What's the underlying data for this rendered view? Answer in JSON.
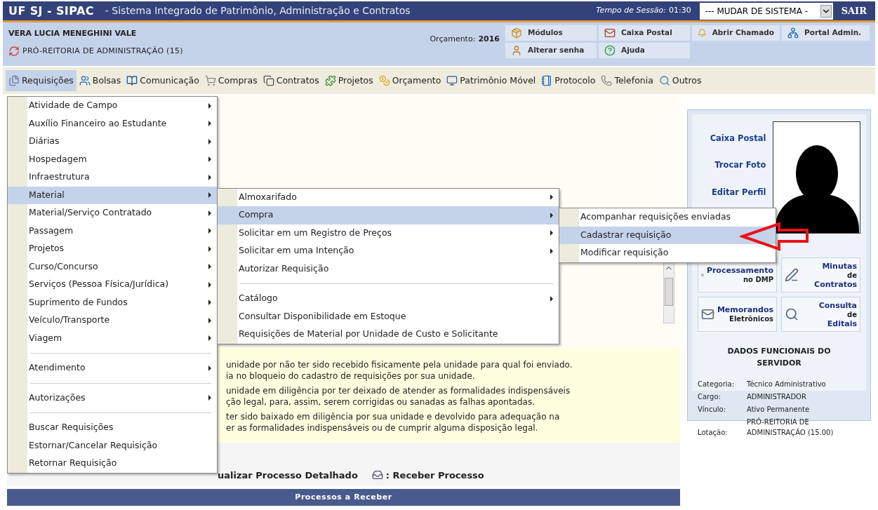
{
  "header": {
    "system_name": "UF SJ - SIPAC",
    "system_description": "- Sistema Integrado de Patrimônio, Administração e Contratos",
    "session_label": "Tempo de Sessão:",
    "session_time": "01:30",
    "system_select": "--- MUDAR DE SISTEMA -",
    "logout": "SAIR"
  },
  "user": {
    "name": "VERA LUCIA MENEGHINI VALE",
    "unit": "PRÓ-REITORIA DE ADMINISTRAÇÃO (15)",
    "budget_label": "Orçamento:",
    "budget_year": "2016"
  },
  "shortcuts": [
    {
      "kind": "modules",
      "label": "Módulos"
    },
    {
      "kind": "mail",
      "label": "Caixa Postal"
    },
    {
      "kind": "bell",
      "label": "Abrir Chamado"
    },
    {
      "kind": "portal",
      "label": "Portal Admin."
    },
    {
      "kind": "user",
      "label": "Alterar senha"
    },
    {
      "kind": "help",
      "label": "Ajuda"
    }
  ],
  "menubar": [
    {
      "kind": "files",
      "label": "Requisições",
      "selected": true
    },
    {
      "kind": "users",
      "label": "Bolsas",
      "selected": false
    },
    {
      "kind": "book",
      "label": "Comunicação",
      "selected": false
    },
    {
      "kind": "cart",
      "label": "Compras",
      "selected": false
    },
    {
      "kind": "copy",
      "label": "Contratos",
      "selected": false
    },
    {
      "kind": "puzzle",
      "label": "Projetos",
      "selected": false
    },
    {
      "kind": "coins",
      "label": "Orçamento",
      "selected": false
    },
    {
      "kind": "monitor",
      "label": "Patrimônio Móvel",
      "selected": false
    },
    {
      "kind": "notebook",
      "label": "Protocolo",
      "selected": false
    },
    {
      "kind": "phone",
      "label": "Telefonia",
      "selected": false
    },
    {
      "kind": "search",
      "label": "Outros",
      "selected": false
    }
  ],
  "menu": {
    "groups": [
      [
        {
          "label": "Atividade de Campo",
          "submenu": true,
          "selected": false
        },
        {
          "label": "Auxílio Financeiro ao Estudante",
          "submenu": true,
          "selected": false
        },
        {
          "label": "Diárias",
          "submenu": true,
          "selected": false
        },
        {
          "label": "Hospedagem",
          "submenu": true,
          "selected": false
        },
        {
          "label": "Infraestrutura",
          "submenu": true,
          "selected": false
        },
        {
          "label": "Material",
          "submenu": true,
          "selected": true,
          "children": {
            "groups": [
              [
                {
                  "label": "Almoxarifado",
                  "submenu": true,
                  "selected": false
                },
                {
                  "label": "Compra",
                  "submenu": true,
                  "selected": true,
                  "children": {
                    "groups": [
                      [
                        {
                          "label": "Acompanhar requisições enviadas",
                          "submenu": false,
                          "selected": false
                        },
                        {
                          "label": "Cadastrar requisição",
                          "submenu": false,
                          "selected": true
                        },
                        {
                          "label": "Modificar requisição",
                          "submenu": false,
                          "selected": false
                        }
                      ]
                    ]
                  }
                },
                {
                  "label": "Solicitar em um Registro de Preços",
                  "submenu": true,
                  "selected": false
                },
                {
                  "label": "Solicitar em uma Intenção",
                  "submenu": true,
                  "selected": false
                },
                {
                  "label": "Autorizar Requisição",
                  "submenu": false,
                  "selected": false
                }
              ],
              [
                {
                  "label": "Catálogo",
                  "submenu": true,
                  "selected": false
                },
                {
                  "label": "Consultar Disponibilidade em Estoque",
                  "submenu": false,
                  "selected": false
                },
                {
                  "label": "Requisições de Material por Unidade de Custo e Solicitante",
                  "submenu": false,
                  "selected": false
                }
              ]
            ]
          }
        },
        {
          "label": "Material/Serviço Contratado",
          "submenu": true,
          "selected": false
        },
        {
          "label": "Passagem",
          "submenu": true,
          "selected": false
        },
        {
          "label": "Projetos",
          "submenu": true,
          "selected": false
        },
        {
          "label": "Curso/Concurso",
          "submenu": true,
          "selected": false
        },
        {
          "label": "Serviços (Pessoa Física/Jurídica)",
          "submenu": true,
          "selected": false
        },
        {
          "label": "Suprimento de Fundos",
          "submenu": true,
          "selected": false
        },
        {
          "label": "Veículo/Transporte",
          "submenu": true,
          "selected": false
        },
        {
          "label": "Viagem",
          "submenu": true,
          "selected": false
        }
      ],
      [
        {
          "label": "Atendimento",
          "submenu": true,
          "selected": false
        }
      ],
      [
        {
          "label": "Autorizações",
          "submenu": true,
          "selected": false
        }
      ],
      [
        {
          "label": "Buscar Requisições",
          "submenu": false,
          "selected": false
        },
        {
          "label": "Estornar/Cancelar Requisição",
          "submenu": false,
          "selected": false
        },
        {
          "label": "Retornar Requisição",
          "submenu": false,
          "selected": false
        }
      ]
    ]
  },
  "notice": {
    "paragraphs": [
      [
        "unidade por não ter sido recebido fisicamente pela unidade para qual foi enviado.",
        "ia no bloqueio do cadastro de requisições por sua unidade."
      ],
      [
        "unidade em diligência por ter deixado de atender as formalidades indispensáveis",
        "ção legal, para, assim, serem corrigidas ou sanadas as falhas apontadas."
      ],
      [
        "ter sido baixado em diligência por sua unidade e devolvido para adequação na",
        "er as formalidades indispensáveis ou de cumprir alguma disposição legal."
      ]
    ]
  },
  "legend": [
    {
      "kind": "view",
      "label": "ualizar Processo Detalhado"
    },
    {
      "kind": "receive",
      "label": ": Receber Processo"
    }
  ],
  "table": {
    "title": "Processos a Receber"
  },
  "sidebar": {
    "links": [
      "Caixa Postal",
      "Trocar Foto",
      "Editar Perfil"
    ],
    "tiles": [
      {
        "kind": "doc",
        "lines": [
          "Processamento",
          "no DMP"
        ]
      },
      {
        "kind": "pen",
        "lines": [
          "Minutas",
          "de",
          "Contratos"
        ]
      },
      {
        "kind": "mail",
        "lines": [
          "Memorandos",
          "Eletrônicos"
        ]
      },
      {
        "kind": "search",
        "lines": [
          "Consulta",
          "de",
          "Editais"
        ]
      }
    ],
    "section_title": "DADOS FUNCIONAIS DO SERVIDOR",
    "fields": [
      {
        "label": "Categoria:",
        "value": "Técnico Administrativo"
      },
      {
        "label": "Cargo:",
        "value": "ADMINISTRADOR"
      },
      {
        "label": "Vínculo:",
        "value": "Ativo Permanente"
      },
      {
        "label": "Lotação:",
        "value": "PRÓ-REITORIA DE ADMINISTRAÇÃO (15.00)"
      }
    ]
  }
}
